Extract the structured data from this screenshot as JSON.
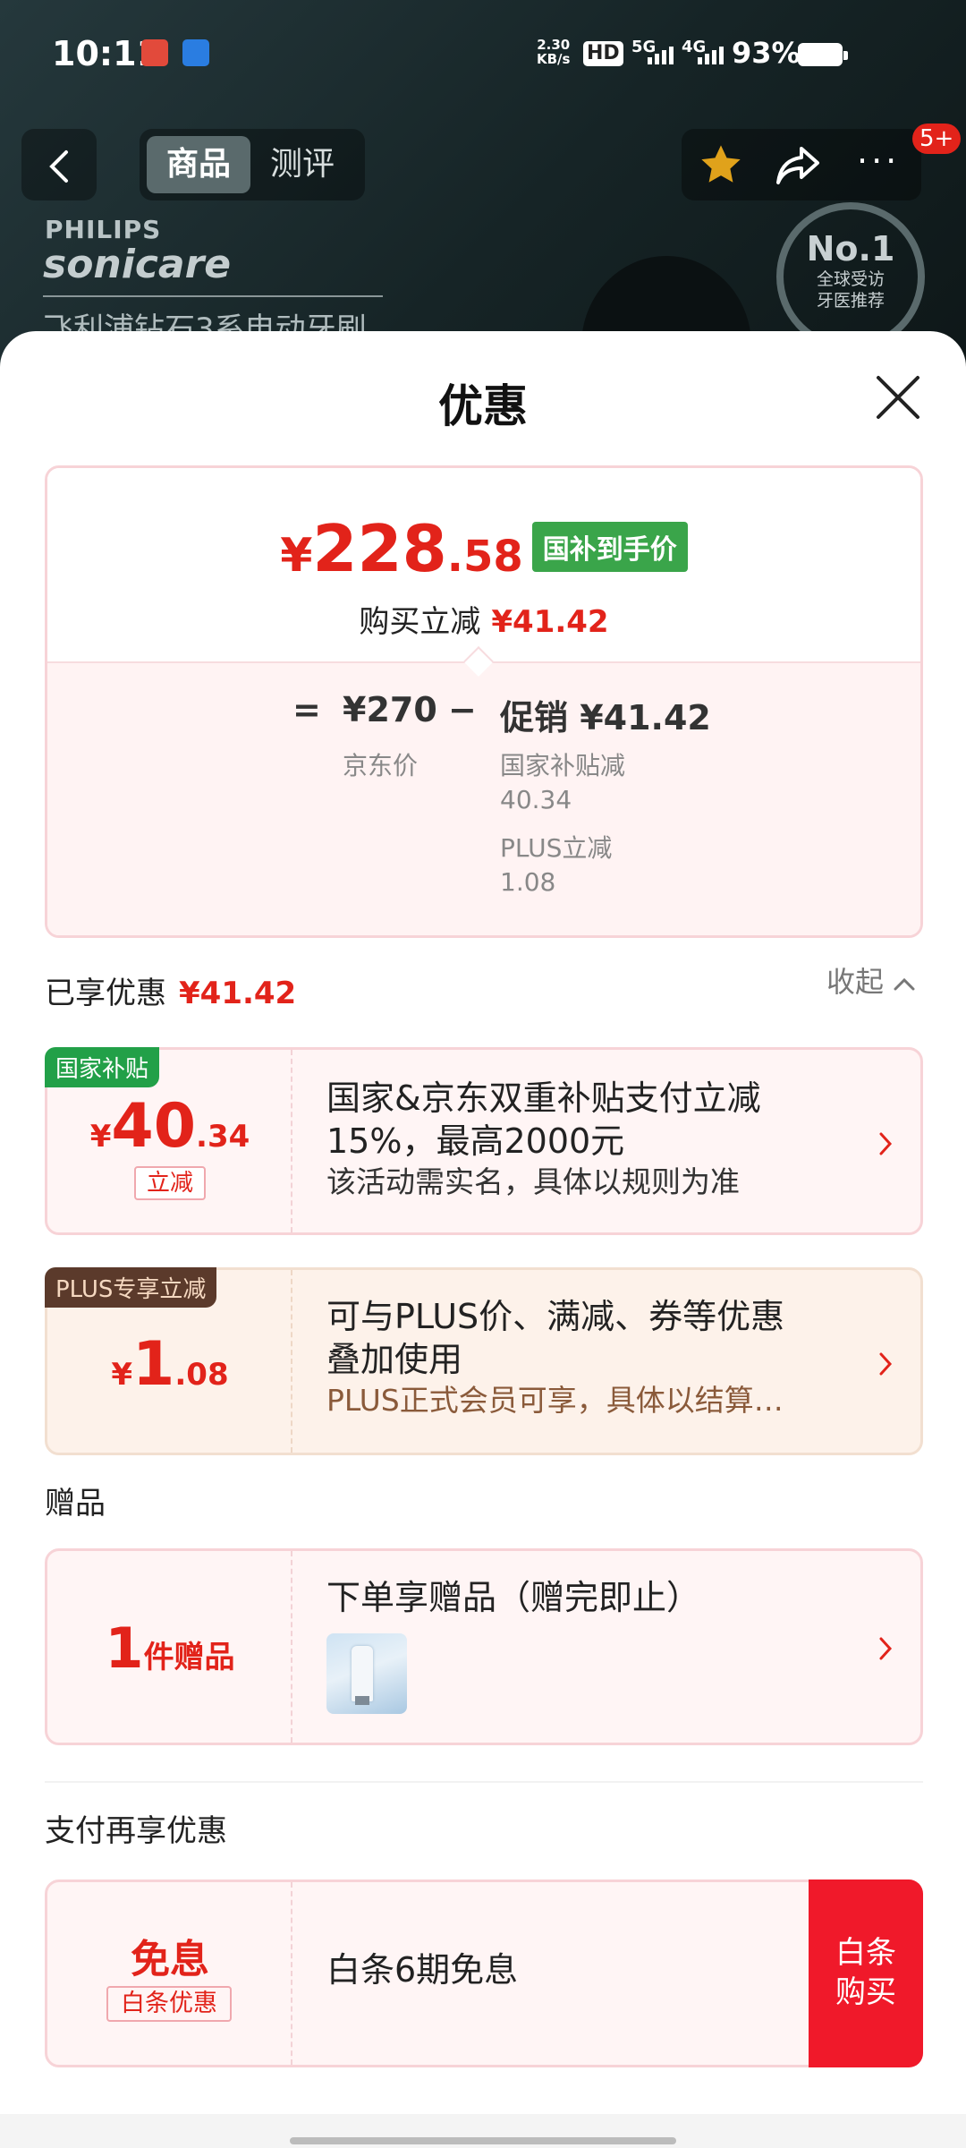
{
  "status_bar": {
    "time": "10:11",
    "net_speed": "2.30",
    "net_speed_unit": "KB/s",
    "hd": "HD",
    "sim1": "5G",
    "sim2": "4G",
    "battery": "93%"
  },
  "nav": {
    "tabs": [
      "商品",
      "测评"
    ],
    "active_tab": "商品",
    "notification_badge": "5+"
  },
  "product_bg": {
    "brand_line1": "PHILIPS",
    "brand_line2": "sonicare",
    "product_name": "飞利浦钻石3系电动牙刷",
    "seal_main": "No.1",
    "seal_line1": "全球受访",
    "seal_line2": "牙医推荐"
  },
  "sheet": {
    "title": "优惠"
  },
  "summary": {
    "currency": "¥",
    "price_int": "228",
    "price_dec": ".58",
    "price_tag": "国补到手价",
    "reduce_label": "购买立减",
    "reduce_value": "¥41.42",
    "eq": "=",
    "jd_price": "¥270",
    "minus": "−",
    "promo": "促销 ¥41.42",
    "jd_price_label": "京东价",
    "sub1_label": "国家补贴减",
    "sub1_value": "40.34",
    "sub2_label": "PLUS立减",
    "sub2_value": "1.08"
  },
  "enjoyed": {
    "title": "已享优惠",
    "value": "¥41.42",
    "collapse": "收起"
  },
  "offers": [
    {
      "corner": "国家补贴",
      "currency": "¥",
      "int": "40",
      "dec": ".34",
      "tag": "立减",
      "line1": "国家&京东双重补贴支付立减",
      "line2": "15%，最高2000元",
      "line3": "该活动需实名，具体以规则为准"
    },
    {
      "corner": "PLUS专享立减",
      "currency": "¥",
      "int": "1",
      "dec": ".08",
      "line1": "可与PLUS价、满减、券等优惠",
      "line2": "叠加使用",
      "line3": "PLUS正式会员可享，具体以结算…"
    }
  ],
  "gift": {
    "title": "赠品",
    "count": "1",
    "unit": "件赠品",
    "line1": "下单享赠品（赠完即止）"
  },
  "pay": {
    "title": "支付再享优惠",
    "main": "免息",
    "tag": "白条优惠",
    "desc": "白条6期免息",
    "btn_line1": "白条",
    "btn_line2": "购买"
  },
  "colors": {
    "accent_red": "#e2231a",
    "subsidy_green": "#3aa54a",
    "plus_brown": "#5b3a2b",
    "pay_button": "#f0192a"
  }
}
